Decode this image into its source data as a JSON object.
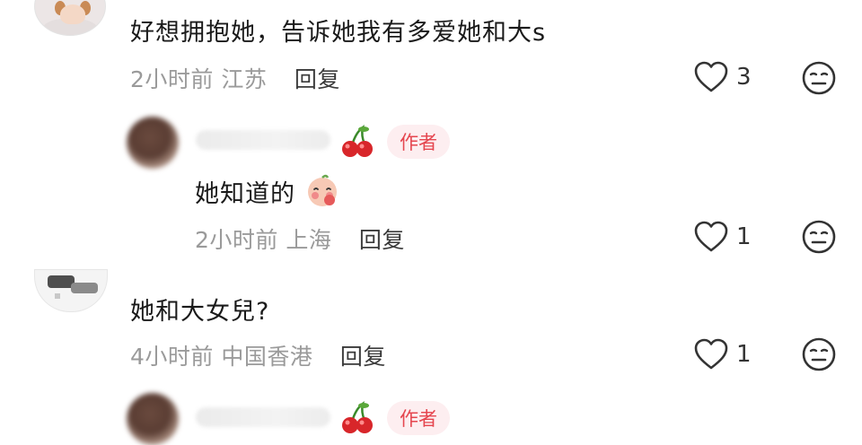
{
  "comments": [
    {
      "text": "好想拥抱她，告诉她我有多爱她和大s",
      "time": "2小时前",
      "location": "江苏",
      "reply_label": "回复",
      "likes": "3"
    },
    {
      "author_badge": "作者",
      "text": "她知道的",
      "emoji": "blush-face-emoji",
      "time": "2小时前",
      "location": "上海",
      "reply_label": "回复",
      "likes": "1"
    },
    {
      "text": "她和大女兒?",
      "time": "4小时前",
      "location": "中国香港",
      "reply_label": "回复",
      "likes": "1"
    },
    {
      "author_badge": "作者"
    }
  ],
  "colors": {
    "badge_text": "#e5464f",
    "badge_bg": "#fdeef0",
    "meta_text": "#9a9a9a",
    "icon": "#333333"
  },
  "icons": [
    "heart-outline-icon",
    "meh-face-icon",
    "cherry-icon"
  ]
}
